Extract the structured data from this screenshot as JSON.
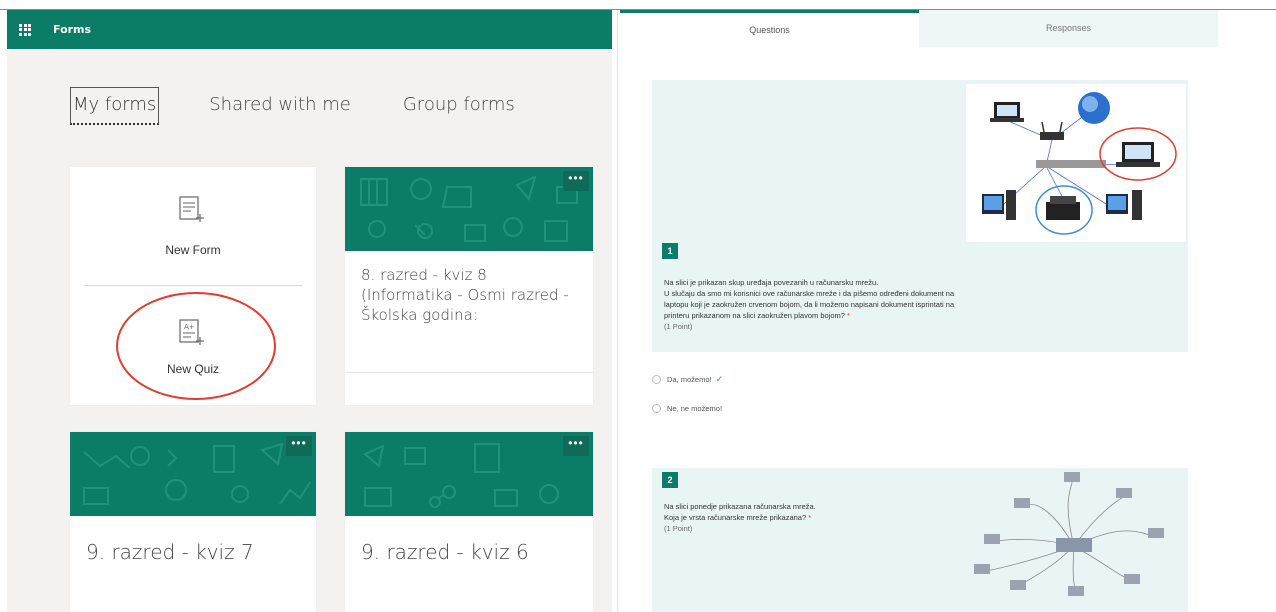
{
  "app": {
    "name": "Forms"
  },
  "tabs": [
    {
      "label": "My forms"
    },
    {
      "label": "Shared with me"
    },
    {
      "label": "Group forms"
    }
  ],
  "new_card": {
    "new_form_label": "New Form",
    "new_quiz_label": "New Quiz"
  },
  "forms": [
    {
      "title": "8. razred - kviz 8 (Informatika - Osmi razred - Školska godina:",
      "more": "•••"
    },
    {
      "title": "9. razred - kviz 7",
      "more": "•••"
    },
    {
      "title": "9. razred - kviz 6",
      "more": "•••"
    }
  ],
  "right": {
    "tabs": [
      {
        "label": "Questions"
      },
      {
        "label": "Responses"
      }
    ],
    "questions": [
      {
        "number": "1",
        "lines": [
          "Na slici je prikazan skup uređaja povezanih u računarsku mrežu.",
          "U slučaju da smo mi korisnici ove računarske mreže i da pišemo određeni dokument na",
          "laptopu koji je zaokružen crvenom bojom, da li možemo napisani dokument isprintati na",
          "printeru prikazanom na slici zaokružen plavom bojom?"
        ],
        "required": "*",
        "points": "(1 Point)",
        "options": [
          {
            "label": "Da, možemo!",
            "correct": "✓"
          },
          {
            "label": "Ne, ne možemo!"
          }
        ]
      },
      {
        "number": "2",
        "lines": [
          "Na slici ponedje prikazana računarska mreža.",
          "Koja je vrsta računarske mreže prikazana?"
        ],
        "required": "*",
        "points": "(1 Point)"
      }
    ]
  },
  "colors": {
    "brand": "#0b7c66",
    "highlight_red": "#e53b2c",
    "highlight_blue": "#3a8fd6"
  }
}
